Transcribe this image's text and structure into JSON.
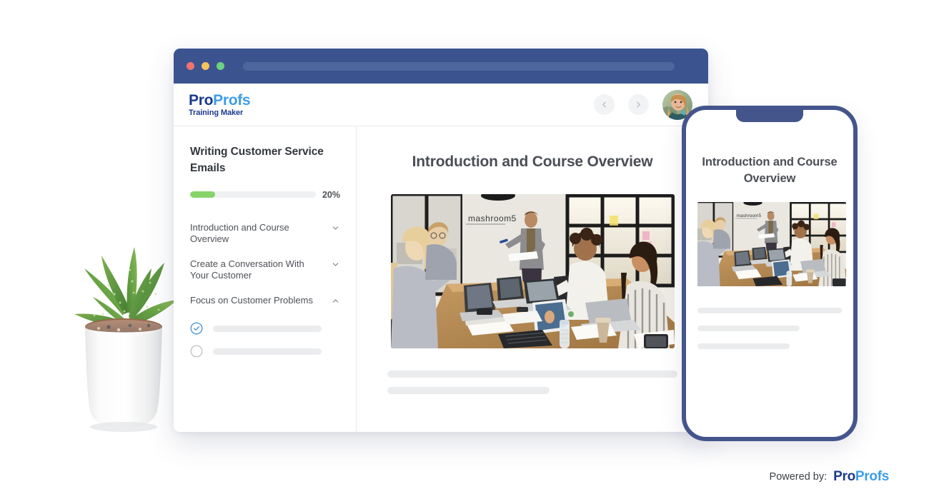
{
  "browser": {
    "traffic_lights": [
      "close",
      "minimize",
      "maximize"
    ],
    "url_placeholder": ""
  },
  "brand": {
    "logo_pro": "Pro",
    "logo_profs": "Profs",
    "logo_subtitle": "Training Maker",
    "color_navy": "#1b3a8c",
    "color_blue": "#3c9ee4"
  },
  "appbar": {
    "prev_label": "",
    "next_label": "",
    "avatar_alt": "user avatar"
  },
  "sidebar": {
    "course_title": "Writing Customer Service Emails",
    "progress": {
      "percent": 20,
      "label": "20%",
      "fill_color": "#86d46b",
      "track_color": "#f0f1f2"
    },
    "modules": [
      {
        "label": "Introduction and Course Overview",
        "expanded": false,
        "chevron": "chevron-down-icon"
      },
      {
        "label": "Create a Conversation With Your Customer",
        "expanded": false,
        "chevron": "chevron-down-icon"
      },
      {
        "label": "Focus on Customer Problems",
        "expanded": true,
        "chevron": "chevron-up-icon"
      }
    ],
    "lessons": [
      {
        "status": "completed",
        "icon": "check-circle-icon",
        "label": ""
      },
      {
        "status": "incomplete",
        "icon": "empty-circle-icon",
        "label": ""
      }
    ],
    "placeholder_rows": 3
  },
  "main": {
    "title": "Introduction and Course Overview",
    "image_alt": "meeting room presentation with laptops",
    "body_placeholder_rows": 2
  },
  "phone": {
    "title": "Introduction and Course Overview",
    "image_alt": "meeting room presentation with laptops",
    "body_placeholder_rows": 3
  },
  "footer": {
    "powered_by": "Powered by:",
    "logo_pro": "Pro",
    "logo_profs": "Profs"
  },
  "decor": {
    "plant_alt": "aloe plant in white ceramic pot"
  }
}
